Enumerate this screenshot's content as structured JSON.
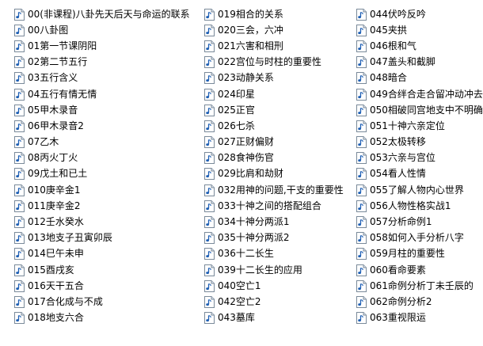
{
  "icons": {
    "file": "audio-file-icon"
  },
  "columns": [
    [
      "00(非课程)八卦先天后天与命运的联系",
      "00八卦图",
      "01第一节课阴阳",
      "02第二节五行",
      "03五行含义",
      "04五行有情无情",
      "05甲木录音",
      "06甲木录音2",
      "07乙木",
      "08丙火丁火",
      "09戊土和已土",
      "010庚辛金1",
      "011庚辛金2",
      "012壬水癸水",
      "013地支子丑寅卯辰",
      "014巳午未申",
      "015酉戌亥",
      "016天干五合",
      "017合化成与不成",
      "018地支六合"
    ],
    [
      "019相合的关系",
      "020三会，六冲",
      "021六害和相刑",
      "022宫位与时柱的重要性",
      "023动静关系",
      "024印星",
      "025正官",
      "026七杀",
      "027正财偏财",
      "028食神伤官",
      "029比肩和劫财",
      "032用神的问题,干支的重要性",
      "033十神之间的搭配组合",
      "034十神分两派1",
      "035十神分两派2",
      "036十二长生",
      "039十二长生的应用",
      "040空亡1",
      "042空亡2",
      "043墓库"
    ],
    [
      "044伏吟反吟",
      "045夹拱",
      "046根和气",
      "047盖头和截脚",
      "048暗合",
      "049合绊合走合留冲动冲去",
      "050相破同宫地支中不明确",
      "051十神六亲定位",
      "052太极转移",
      "053六亲与宫位",
      "054看人性情",
      "055了解人物内心世界",
      "056人物性格实战1",
      "057分析命例1",
      "058如何入手分析八字",
      "059月柱的重要性",
      "060看命要素",
      "061命例分析丁未壬辰的",
      "062命例分析2",
      "063重视限运"
    ]
  ]
}
